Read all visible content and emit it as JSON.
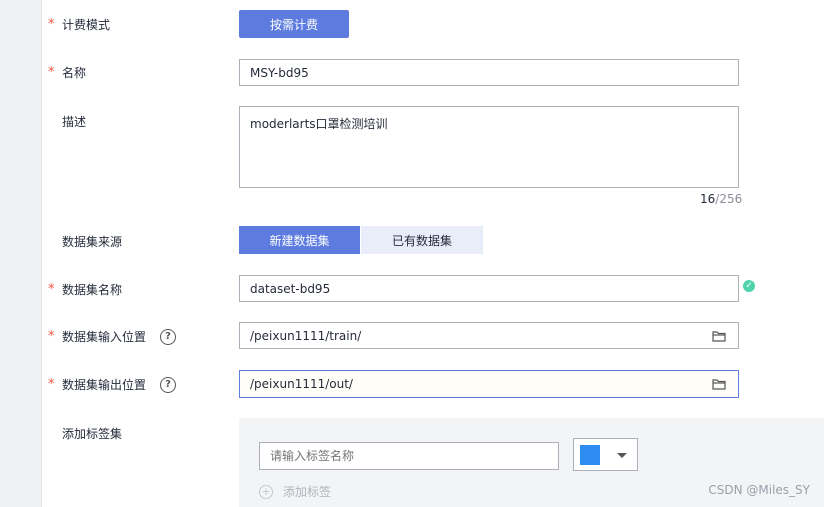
{
  "form": {
    "billing_mode": {
      "label": "计费模式",
      "option": "按需计费"
    },
    "name": {
      "label": "名称",
      "value": "MSY-bd95"
    },
    "description": {
      "label": "描述",
      "value": "moderlarts口罩检测培训",
      "count": "16",
      "max": "/256"
    },
    "dataset_source": {
      "label": "数据集来源",
      "options": [
        "新建数据集",
        "已有数据集"
      ]
    },
    "dataset_name": {
      "label": "数据集名称",
      "value": "dataset-bd95"
    },
    "input_location": {
      "label": "数据集输入位置",
      "value": "/peixun1111/train/"
    },
    "output_location": {
      "label": "数据集输出位置",
      "value": "/peixun1111/out/"
    },
    "label_set": {
      "label": "添加标签集",
      "placeholder": "请输入标签名称",
      "color": "#2d8cf0",
      "add_label": "添加标签"
    }
  },
  "required_mark": "*",
  "help_mark": "?",
  "watermark": "CSDN @Miles_SY",
  "colors": {
    "primary": "#5e7ce0",
    "required": "#f4523b",
    "success": "#50d4ab"
  }
}
